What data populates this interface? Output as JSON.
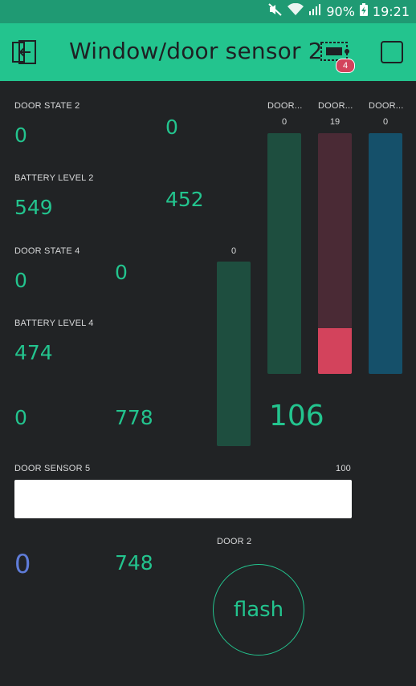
{
  "status_bar": {
    "battery_percent": "90%",
    "time": "19:21"
  },
  "app_bar": {
    "title": "Window/door sensor 2",
    "badge_count": "4"
  },
  "widgets": {
    "door_state_2": {
      "label": "DOOR STATE 2",
      "value": "0"
    },
    "value_col2_row1": "0",
    "battery_level_2": {
      "label": "BATTERY LEVEL 2",
      "value": "549"
    },
    "value_col2_row2": "452",
    "door_state_4": {
      "label": "DOOR STATE 4",
      "value": "0"
    },
    "value_col2_row3": "0",
    "battery_level_4": {
      "label": "BATTERY LEVEL 4",
      "value": "474"
    },
    "value_row5_a": "0",
    "value_row5_b": "778",
    "big_value": "106",
    "door_sensor_5": {
      "label": "DOOR SENSOR 5",
      "max": "100",
      "level": 1.0
    },
    "value_row7_a": "0",
    "value_row7_b": "748",
    "door_2": {
      "label": "DOOR 2",
      "button_label": "flash"
    }
  },
  "vertical_bars": [
    {
      "label": "",
      "max": "0",
      "level": 0.0,
      "track": "#1e4e3f",
      "fill": "#23c48e"
    },
    {
      "label": "DOOR...",
      "max": "0",
      "level": 0.0,
      "track": "#1e4e3f",
      "fill": "#23c48e"
    },
    {
      "label": "DOOR...",
      "max": "19",
      "level": 0.19,
      "track": "#4a2a35",
      "fill": "#d3435c"
    },
    {
      "label": "DOOR...",
      "max": "0",
      "level": 0.0,
      "track": "#15506a",
      "fill": "#04c0f8"
    }
  ],
  "colors": {
    "accent": "#23c48e",
    "background": "#212325",
    "red": "#d3435c",
    "blue": "#5f7cd8"
  }
}
